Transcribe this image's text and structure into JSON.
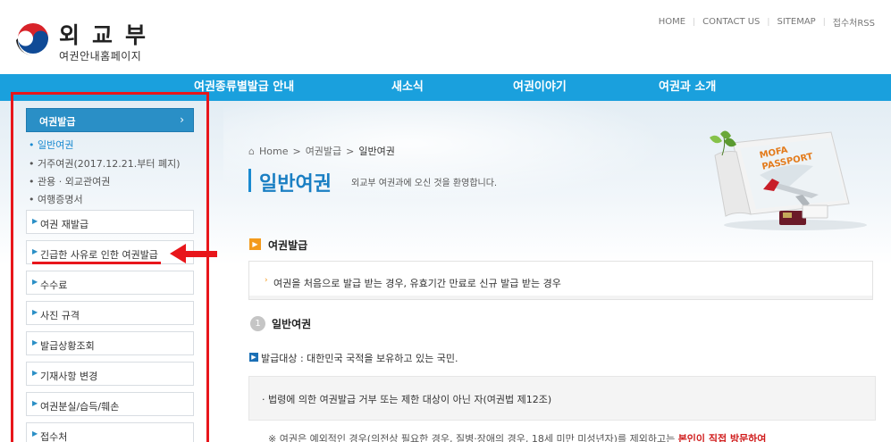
{
  "header": {
    "logo_main": "외교부",
    "logo_sub": "여권안내홈페이지",
    "utility": [
      "HOME",
      "CONTACT US",
      "SITEMAP",
      "접수처RSS"
    ]
  },
  "gnb": [
    "여권종류별발급 안내",
    "새소식",
    "여권이야기",
    "여권과 소개"
  ],
  "lnb": {
    "head": "여권발급",
    "sub_items": [
      "일반여권",
      "거주여권(2017.12.21.부터 폐지)",
      "관용 · 외교관여권",
      "여행증명서"
    ],
    "menu": [
      "여권 재발급",
      "긴급한 사유로 인한 여권발급",
      "수수료",
      "사진 규격",
      "발급상황조회",
      "기재사항 변경",
      "여권분실/습득/훼손",
      "접수처"
    ]
  },
  "breadcrumb": [
    "Home",
    "여권발급",
    "일반여권"
  ],
  "page": {
    "title": "일반여권",
    "desc": "외교부 여권과에 오신 것을 환영합니다."
  },
  "passport_label": [
    "MOFA",
    "PASSPORT"
  ],
  "section": {
    "title": "여권발급",
    "info": "여권을 처음으로 발급 받는 경우, 유효기간 만료로 신규 발급 받는 경우",
    "sub_number": "1",
    "sub_title": "일반여권",
    "target": "발급대상 : 대한민국 국적을 보유하고 있는 국민.",
    "condition": "· 법령에 의한 여권발급 거부 또는 제한 대상이 아닌 자(여권법 제12조)",
    "note": "※ 여권은 예외적인 경우(의전상 필요한 경우, 질병·장애의 경우, 18세 미만 미성년자)를 제외하고는 ",
    "note_emphasis": "본인이 직접 방문하여"
  },
  "colors": {
    "gnb": "#1aa0dd",
    "accent": "#1a7fc3",
    "highlight": "#e8161b",
    "orange": "#f39a1c"
  }
}
